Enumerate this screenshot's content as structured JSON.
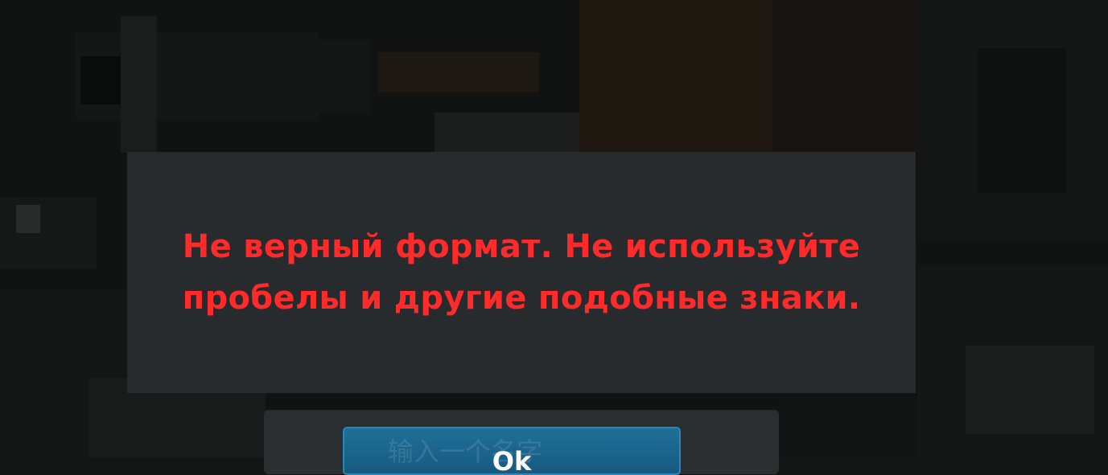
{
  "alert": {
    "message": "Не верный формат. Не используйте пробелы и другие подобные знаки."
  },
  "dialog": {
    "input_placeholder": "输入一个名字",
    "ok_label": "Ok"
  },
  "colors": {
    "alert_text": "#ff2b2b",
    "alert_background": "#272b2d",
    "button_blue": "#1f6f99"
  }
}
